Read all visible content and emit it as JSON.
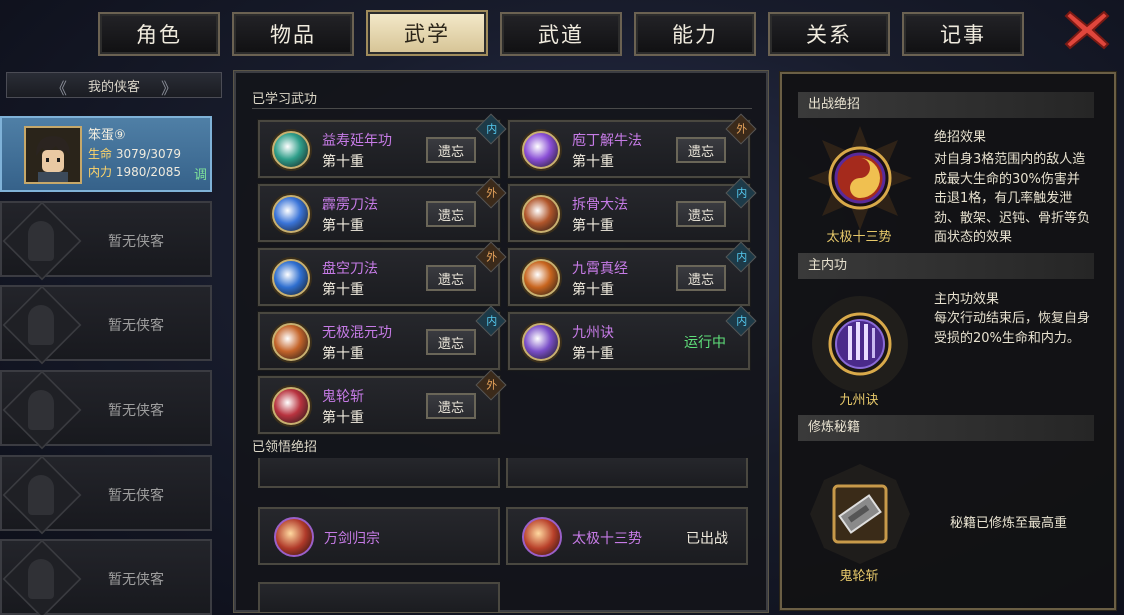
{
  "tabs": [
    "角色",
    "物品",
    "武学",
    "武道",
    "能力",
    "关系",
    "记事"
  ],
  "active_tab_index": 2,
  "hero_list": {
    "header": "我的侠客",
    "active_hero": {
      "name": "笨蛋⑨",
      "hp_label": "生命",
      "hp_value": "3079/3079",
      "mp_label": "内力",
      "mp_value": "1980/2085",
      "tag": "调"
    },
    "empty_label": "暂无侠客",
    "empty_slots": 5
  },
  "learned": {
    "title": "已学习武功",
    "forget_label": "遗忘",
    "running_label": "运行中",
    "skills": [
      {
        "name": "益寿延年功",
        "level": "第十重",
        "badge": "内",
        "type": "nei",
        "action": "forget",
        "color": "#2f9e8a"
      },
      {
        "name": "庖丁解牛法",
        "level": "第十重",
        "badge": "外",
        "type": "wai",
        "action": "forget",
        "color": "#8a4fd6"
      },
      {
        "name": "霹雳刀法",
        "level": "第十重",
        "badge": "外",
        "type": "wai",
        "action": "forget",
        "color": "#3a74d8"
      },
      {
        "name": "拆骨大法",
        "level": "第十重",
        "badge": "内",
        "type": "nei",
        "action": "forget",
        "color": "#b0552a"
      },
      {
        "name": "盘空刀法",
        "level": "第十重",
        "badge": "外",
        "type": "wai",
        "action": "forget",
        "color": "#2f6fd0"
      },
      {
        "name": "九霄真经",
        "level": "第十重",
        "badge": "内",
        "type": "nei",
        "action": "forget",
        "color": "#c8651f"
      },
      {
        "name": "无极混元功",
        "level": "第十重",
        "badge": "内",
        "type": "nei",
        "action": "forget",
        "color": "#c4642a"
      },
      {
        "name": "九州诀",
        "level": "第十重",
        "badge": "内",
        "type": "nei",
        "action": "running",
        "color": "#7a4fc8"
      },
      {
        "name": "鬼轮斩",
        "level": "第十重",
        "badge": "外",
        "type": "wai",
        "action": "forget",
        "color": "#b8333f"
      }
    ]
  },
  "ultimates": {
    "title": "已领悟绝招",
    "items": [
      {
        "name": "万剑归宗",
        "status": "",
        "color": "#b03a2a"
      },
      {
        "name": "太极十三势",
        "status": "已出战",
        "color": "#b8402a"
      }
    ]
  },
  "right": {
    "battle_head": "出战绝招",
    "battle_subtitle": "绝招效果",
    "battle_text": "对自身3格范围内的敌人造成最大生命的30%伤害并击退1格，有几率触发泄劲、散架、迟钝、骨折等负面状态的效果",
    "battle_caption": "太极十三势",
    "inner_head": "主内功",
    "inner_subtitle": "主内功效果",
    "inner_text": "每次行动结束后，恢复自身受损的20%生命和内力。",
    "inner_caption": "九州诀",
    "book_head": "修炼秘籍",
    "book_text": "秘籍已修炼至最高重",
    "book_caption": "鬼轮斩"
  }
}
